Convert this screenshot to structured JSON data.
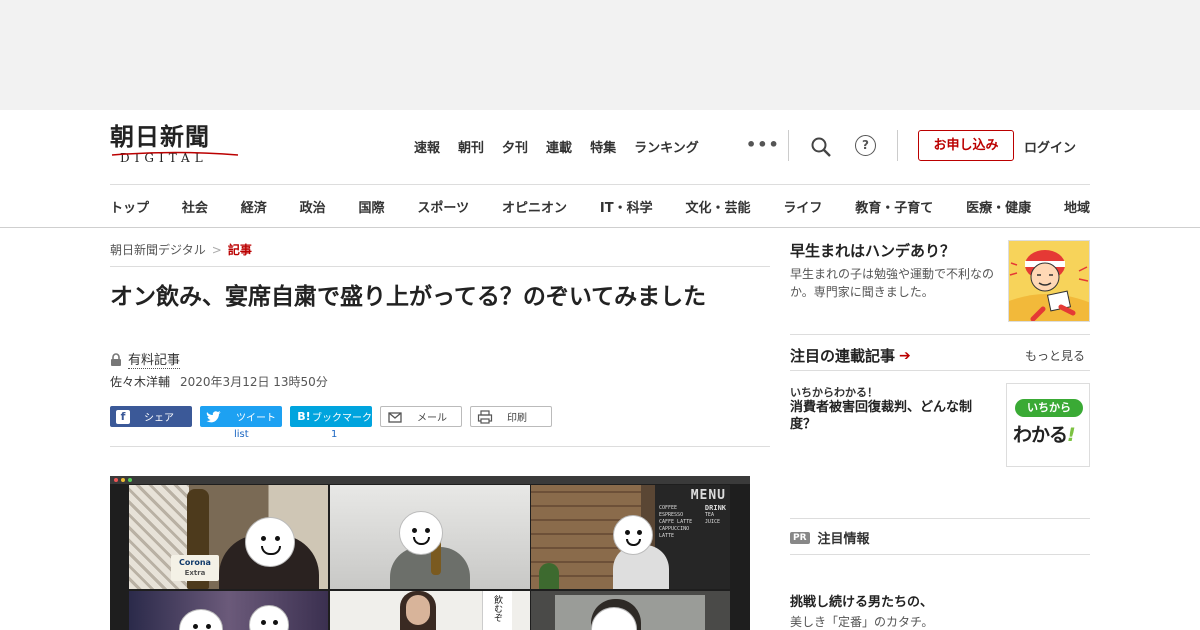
{
  "header": {
    "logo_jp": "朝日新聞",
    "logo_en": "DIGITAL",
    "top_nav": [
      "速報",
      "朝刊",
      "夕刊",
      "連載",
      "特集",
      "ランキング"
    ],
    "more_label": "•••",
    "help_label": "?",
    "apply_label": "お申し込み",
    "login_label": "ログイン",
    "categories": [
      "トップ",
      "社会",
      "経済",
      "政治",
      "国際",
      "スポーツ",
      "オピニオン",
      "IT・科学",
      "文化・芸能",
      "ライフ",
      "教育・子育て",
      "医療・健康",
      "地域"
    ]
  },
  "breadcrumb": {
    "home": "朝日新聞デジタル",
    "separator": ">",
    "current": "記事"
  },
  "article": {
    "title": "オン飲み、宴席自粛で盛り上がってる？のぞいてみました",
    "paid_label": "有料記事",
    "author": "佐々木洋輔",
    "date": "2020年3月12日 13時50分"
  },
  "share": {
    "facebook": "シェア",
    "twitter": "ツイート",
    "hatena_icon": "B!",
    "hatena": "ブックマーク",
    "mail": "メール",
    "print": "印刷",
    "twitter_count": "list",
    "hatena_count": "1"
  },
  "photo": {
    "bottle_label": "Corona",
    "bottle_sub": "Extra",
    "menu_title": "MENU",
    "menu_left": [
      "COFFEE",
      "ESPRESSO",
      "CAFFE LATTE",
      "CAPPUCCINO",
      "LATTE"
    ],
    "menu_right": [
      "DRINK",
      "TEA",
      "JUICE"
    ],
    "sign_text": "飲むぞ"
  },
  "sidebar": {
    "feature_title": "早生まれはハンデあり？",
    "feature_desc": "早生まれの子は勉強や運動で不利なのか。専門家に聞きました。",
    "series_heading": "注目の連載記事",
    "series_arrow": "➔",
    "more_label": "もっと見る",
    "series_kicker": "いちからわかる！",
    "series_title": "消費者被害回復裁判、どんな制度？",
    "wakaru_top": "いちから",
    "wakaru_bottom": "わかる",
    "wakaru_mark": "!",
    "pr_badge": "PR",
    "pr_heading": "注目情報",
    "pr_title": "挑戦し続ける男たちの、",
    "pr_desc": "美しき「定番」のカタチ。"
  },
  "colors": {
    "accent_red": "#b00000",
    "facebook": "#3b5998",
    "twitter": "#1da1f2",
    "hatena": "#00a4de",
    "wakaru_green": "#3aaa35"
  }
}
